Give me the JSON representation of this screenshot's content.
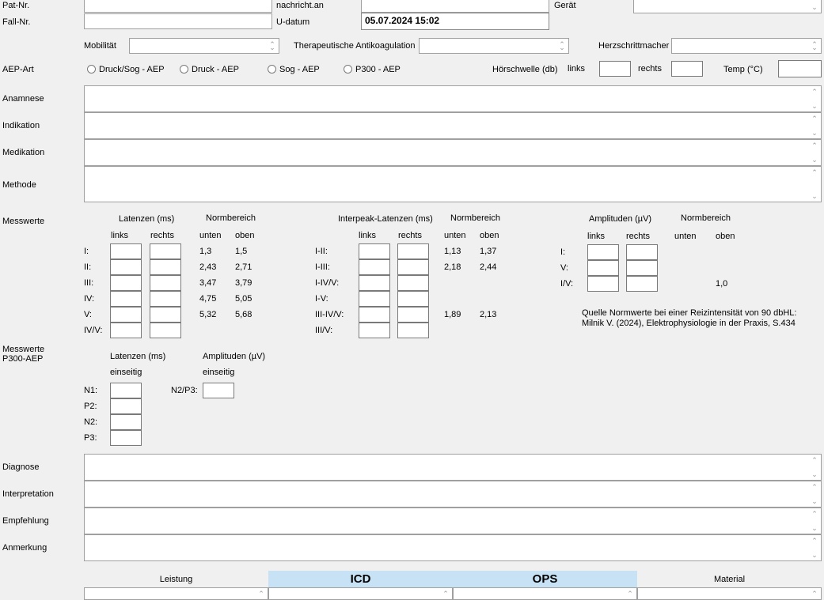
{
  "header": {
    "pat_nr": "Pat-Nr.",
    "fall_nr": "Fall-Nr.",
    "nachricht_an": "nachricht.an",
    "u_datum": "U-datum",
    "u_datum_value": "05.07.2024 15:02",
    "geraet": "Gerät"
  },
  "row2": {
    "mobilitaet": "Mobilität",
    "antikoagulation": "Therapeutische Antikoagulation",
    "herzschrittmacher": "Herzschrittmacher"
  },
  "aep": {
    "label": "AEP-Art",
    "options": [
      "Druck/Sog - AEP",
      "Druck - AEP",
      "Sog - AEP",
      "P300 - AEP"
    ],
    "hoerschwelle": "Hörschwelle (db)",
    "links": "links",
    "rechts": "rechts",
    "temp": "Temp (°C)"
  },
  "text_sections": {
    "anamnese": "Anamnese",
    "indikation": "Indikation",
    "medikation": "Medikation",
    "methode": "Methode"
  },
  "messwerte": {
    "label": "Messwerte",
    "latenzen": {
      "title": "Latenzen (ms)",
      "normbereich": "Normbereich",
      "links": "links",
      "rechts": "rechts",
      "unten": "unten",
      "oben": "oben",
      "rows": [
        {
          "label": "I:",
          "unten": "1,3",
          "oben": "1,5"
        },
        {
          "label": "II:",
          "unten": "2,43",
          "oben": "2,71"
        },
        {
          "label": "III:",
          "unten": "3,47",
          "oben": "3,79"
        },
        {
          "label": "IV:",
          "unten": "4,75",
          "oben": "5,05"
        },
        {
          "label": "V:",
          "unten": "5,32",
          "oben": "5,68"
        },
        {
          "label": "IV/V:",
          "unten": "",
          "oben": ""
        }
      ]
    },
    "interpeak": {
      "title": "Interpeak-Latenzen (ms)",
      "normbereich": "Normbereich",
      "links": "links",
      "rechts": "rechts",
      "unten": "unten",
      "oben": "oben",
      "rows": [
        {
          "label": "I-II:",
          "unten": "1,13",
          "oben": "1,37"
        },
        {
          "label": "I-III:",
          "unten": "2,18",
          "oben": "2,44"
        },
        {
          "label": "I-IV/V:",
          "unten": "",
          "oben": ""
        },
        {
          "label": "I-V:",
          "unten": "",
          "oben": ""
        },
        {
          "label": "III-IV/V:",
          "unten": "1,89",
          "oben": "2,13"
        },
        {
          "label": "III/V:",
          "unten": "",
          "oben": ""
        }
      ]
    },
    "amplituden": {
      "title": "Amplituden (µV)",
      "normbereich": "Normbereich",
      "links": "links",
      "rechts": "rechts",
      "unten": "unten",
      "oben": "oben",
      "rows": [
        {
          "label": "I:",
          "oben": ""
        },
        {
          "label": "V:",
          "oben": ""
        },
        {
          "label": "I/V:",
          "oben": "1,0"
        }
      ]
    },
    "quelle_line1": "Quelle Normwerte bei einer Reizintensität von 90 dbHL:",
    "quelle_line2": "Milnik V. (2024), Elektrophysiologie in der Praxis, S.434"
  },
  "p300": {
    "label_line1": "Messwerte",
    "label_line2": "P300-AEP",
    "latenzen": "Latenzen (ms)",
    "einseitig": "einseitig",
    "amplituden": "Amplituden (µV)",
    "amp_einseitig": "einseitig",
    "rows": [
      "N1:",
      "P2:",
      "N2:",
      "P3:"
    ],
    "n2p3": "N2/P3:"
  },
  "bottom_sections": {
    "diagnose": "Diagnose",
    "interpretation": "Interpretation",
    "empfehlung": "Empfehlung",
    "anmerkung": "Anmerkung"
  },
  "footer": {
    "leistung": "Leistung",
    "icd": "ICD",
    "ops": "OPS",
    "material": "Material"
  }
}
